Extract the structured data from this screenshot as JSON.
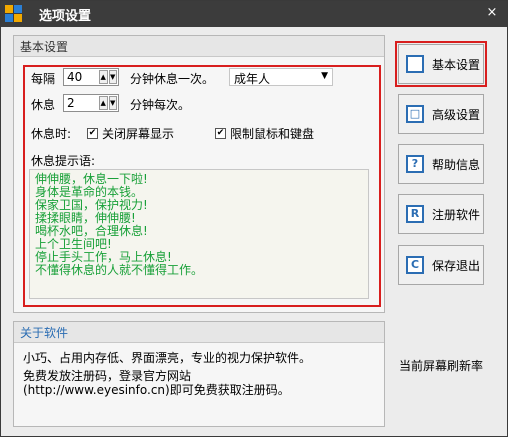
{
  "window": {
    "title": "选项设置",
    "close_glyph": "×"
  },
  "basic": {
    "panel_title": "基本设置",
    "every_label": "每隔",
    "interval_value": "40",
    "interval_suffix": "分钟休息一次。",
    "profile_value": "成年人",
    "rest_label": "休息",
    "rest_value": "2",
    "rest_suffix": "分钟每次。",
    "during_rest_label": "休息时:",
    "close_screen_label": "关闭屏幕显示",
    "close_screen_checked": true,
    "lock_input_label": "限制鼠标和键盘",
    "lock_input_checked": true,
    "tips_label": "休息提示语:",
    "tips": [
      "伸伸腰，休息一下啦!",
      "身体是革命的本钱。",
      "保家卫国，保护视力!",
      "揉揉眼睛，伸伸腰!",
      "喝杯水吧，合理休息!",
      "上个卫生间吧!",
      "停止手头工作，马上休息!",
      "不懂得休息的人就不懂得工作。"
    ]
  },
  "about": {
    "panel_title": "关于软件",
    "line1": "小巧、占用内存低、界面漂亮，专业的视力保护软件。",
    "line2": "免费发放注册码，登录官方网站",
    "line3": "(http://www.eyesinfo.cn)即可免费获取注册码。"
  },
  "side": {
    "buttons": [
      {
        "label": "基本设置",
        "icon": "square-icon",
        "glyph": ""
      },
      {
        "label": "高级设置",
        "icon": "square-icon",
        "glyph": "□"
      },
      {
        "label": "帮助信息",
        "icon": "help-icon",
        "glyph": "?"
      },
      {
        "label": "注册软件",
        "icon": "register-icon",
        "glyph": "R"
      },
      {
        "label": "保存退出",
        "icon": "save-exit-icon",
        "glyph": "C"
      }
    ],
    "refresh_label": "当前屏幕刷新率"
  },
  "colors": {
    "highlight": "#d81e1e",
    "tips_text": "#18a038",
    "icon_blue": "#2b6db3",
    "titlebar": "#3c3c3c"
  }
}
